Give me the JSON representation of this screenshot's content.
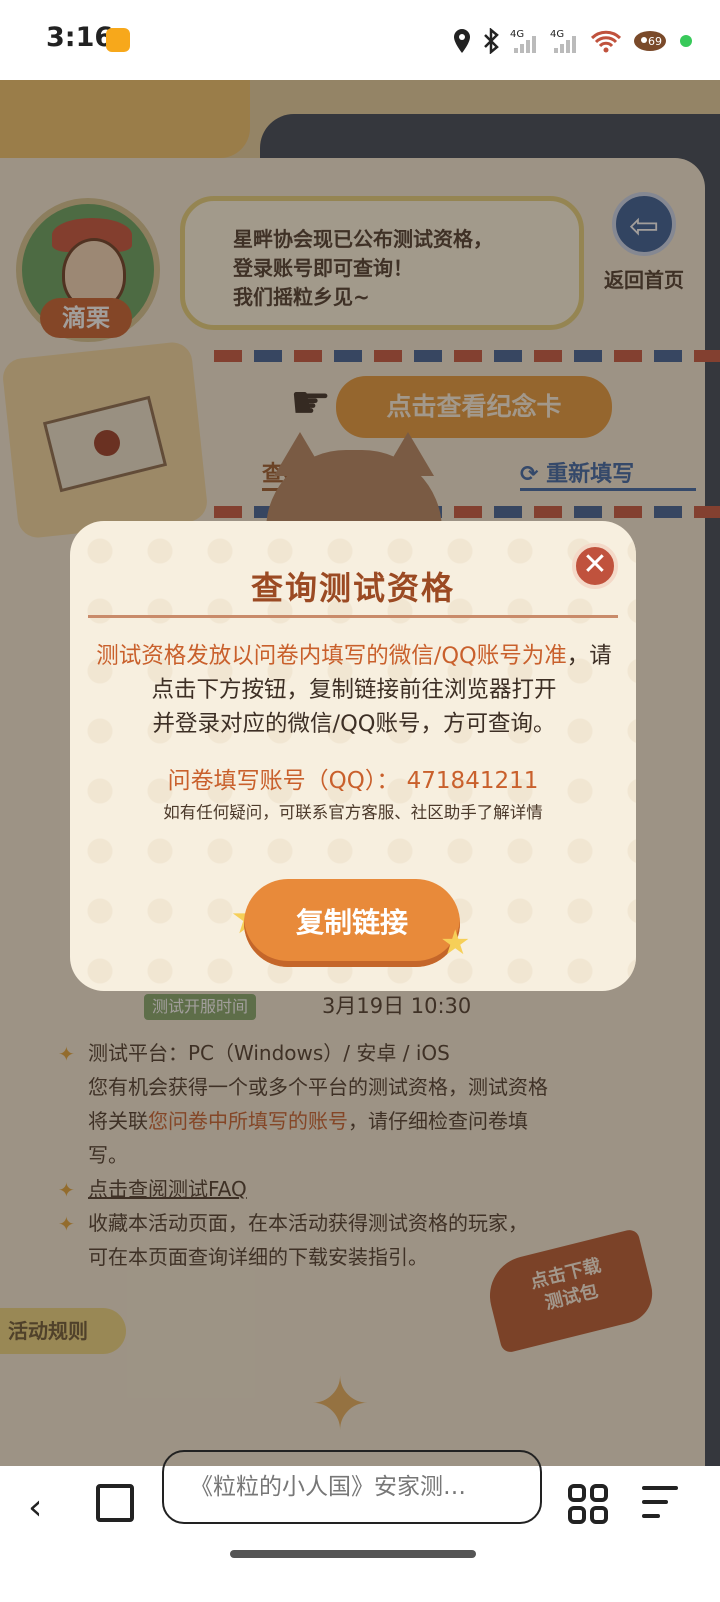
{
  "status_bar": {
    "time": "3:16",
    "indicators": [
      "location-icon",
      "bluetooth-icon",
      "4G",
      "signal-icon",
      "4G",
      "signal-icon",
      "wifi-icon",
      "battery-icon"
    ]
  },
  "page": {
    "character_name": "滴栗",
    "speech": [
      "星畔协会现已公布测试资格，",
      "登录账号即可查询！",
      "我们摇粒乡见~"
    ],
    "home_label": "返回首页",
    "card_button": "点击查看纪念卡",
    "link_left": "查看答案记录",
    "link_right": "重新填写",
    "test_time_tag": "测试开服时间",
    "test_time": "3月19日  10:30",
    "platform": "测试平台：PC（Windows）/ 安卓 / iOS",
    "platform_note_1": "您有机会获得一个或多个平台的测试资格，测试资格",
    "platform_note_2a": "将关联",
    "platform_note_2b": "您问卷中所填写的账号",
    "platform_note_2c": "，请仔细检查问卷填",
    "platform_note_3": "写。",
    "faq_link": "点击查阅测试FAQ",
    "bookmark_note_1": "收藏本活动页面，在本活动获得测试资格的玩家，",
    "bookmark_note_2": "可在本页面查询详细的下载安装指引。",
    "rules_tab": "活动规则",
    "download_badge_1": "点击下载",
    "download_badge_2": "测试包"
  },
  "modal": {
    "title": "查询测试资格",
    "body_highlight": "测试资格发放以问卷内填写的微信/QQ账号为准",
    "body_rest_1": "，请点击下方按钮，复制链接前往浏览器打开",
    "body_rest_2": "并登录对应的微信/QQ账号，方可查询。",
    "account_line": "问卷填写账号（QQ）：  471841211",
    "help_line": "如有任何疑问，可联系官方客服、社区助手了解详情",
    "copy_button": "复制链接",
    "close_label": "✕"
  },
  "browser": {
    "address": "《粒粒的小人国》安家测…"
  },
  "colors": {
    "accent": "#c9602c",
    "title": "#9b4a23",
    "button": "#e88a3a",
    "close": "#c0523d"
  }
}
